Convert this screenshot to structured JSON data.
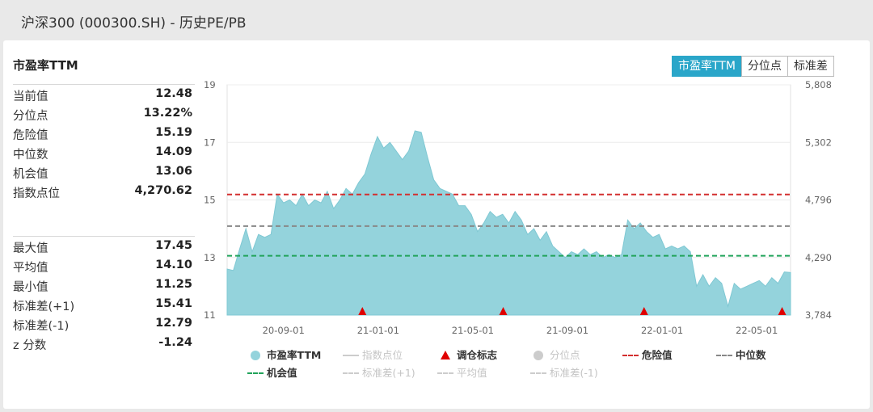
{
  "header": {
    "title": "沪深300 (000300.SH) - 历史PE/PB"
  },
  "stats": {
    "title": "市盈率TTM",
    "group1": [
      {
        "label": "当前值",
        "value": "12.48"
      },
      {
        "label": "分位点",
        "value": "13.22%"
      },
      {
        "label": "危险值",
        "value": "15.19"
      },
      {
        "label": "中位数",
        "value": "14.09"
      },
      {
        "label": "机会值",
        "value": "13.06"
      },
      {
        "label": "指数点位",
        "value": "4,270.62"
      }
    ],
    "group2": [
      {
        "label": "最大值",
        "value": "17.45"
      },
      {
        "label": "平均值",
        "value": "14.10"
      },
      {
        "label": "最小值",
        "value": "11.25"
      },
      {
        "label": "标准差(+1)",
        "value": "15.41"
      },
      {
        "label": "标准差(-1)",
        "value": "12.79"
      },
      {
        "label": "z 分数",
        "value": "-1.24"
      }
    ]
  },
  "tabs": [
    {
      "label": "市盈率TTM",
      "active": true
    },
    {
      "label": "分位点",
      "active": false
    },
    {
      "label": "标准差",
      "active": false
    }
  ],
  "chart_data": {
    "type": "area",
    "left_axis": {
      "ticks": [
        "19",
        "17",
        "15",
        "13",
        "11"
      ],
      "range": [
        11,
        19
      ]
    },
    "right_axis": {
      "ticks": [
        "5,808",
        "5,302",
        "4,796",
        "4,290",
        "3,784"
      ],
      "range": [
        3784,
        5808
      ]
    },
    "x_ticks": [
      "20-09-01",
      "21-01-01",
      "21-05-01",
      "21-09-01",
      "22-01-01",
      "22-05-01"
    ],
    "series": [
      {
        "name": "市盈率TTM",
        "color": "#94d3dc",
        "values": [
          12.6,
          12.55,
          13.3,
          14.0,
          13.2,
          13.8,
          13.7,
          13.8,
          15.2,
          14.9,
          15.0,
          14.8,
          15.2,
          14.8,
          15.0,
          14.9,
          15.3,
          14.7,
          15.0,
          15.4,
          15.2,
          15.6,
          15.9,
          16.6,
          17.2,
          16.8,
          17.0,
          16.7,
          16.4,
          16.7,
          17.4,
          17.35,
          16.5,
          15.7,
          15.4,
          15.3,
          15.2,
          14.8,
          14.8,
          14.5,
          13.9,
          14.2,
          14.6,
          14.4,
          14.5,
          14.2,
          14.6,
          14.3,
          13.8,
          14.0,
          13.6,
          13.9,
          13.4,
          13.2,
          13.0,
          13.2,
          13.1,
          13.3,
          13.1,
          13.2,
          13.0,
          13.1,
          13.0,
          13.1,
          14.3,
          14.0,
          14.2,
          13.9,
          13.7,
          13.8,
          13.3,
          13.4,
          13.3,
          13.4,
          13.2,
          12.0,
          12.4,
          12.0,
          12.3,
          12.1,
          11.3,
          12.1,
          11.9,
          12.0,
          12.1,
          12.2,
          12.0,
          12.3,
          12.1,
          12.5,
          12.48
        ]
      }
    ],
    "reference_lines": [
      {
        "name": "危险值",
        "value": 15.19,
        "color": "#d32f2f"
      },
      {
        "name": "中位数",
        "value": 14.09,
        "color": "#888888"
      },
      {
        "name": "机会值",
        "value": 13.06,
        "color": "#21a35a"
      }
    ],
    "markers": {
      "name": "调仓标志",
      "color": "#e00000",
      "x_fraction": [
        0.24,
        0.49,
        0.74,
        0.985
      ]
    },
    "legend": [
      {
        "name": "市盈率TTM",
        "symbol": "dot",
        "color": "#94d3dc",
        "active": true
      },
      {
        "name": "指数点位",
        "symbol": "line",
        "color": "#cccccc",
        "active": false
      },
      {
        "name": "调仓标志",
        "symbol": "triangle",
        "color": "#e00000",
        "active": true
      },
      {
        "name": "分位点",
        "symbol": "dot",
        "color": "#cccccc",
        "active": false
      },
      {
        "name": "危险值",
        "symbol": "dash",
        "color": "#d32f2f",
        "active": true
      },
      {
        "name": "中位数",
        "symbol": "dash",
        "color": "#888888",
        "active": true
      },
      {
        "name": "机会值",
        "symbol": "dash",
        "color": "#21a35a",
        "active": true
      },
      {
        "name": "标准差(+1)",
        "symbol": "dash",
        "color": "#cccccc",
        "active": false
      },
      {
        "name": "平均值",
        "symbol": "dash",
        "color": "#cccccc",
        "active": false
      },
      {
        "name": "标准差(-1)",
        "symbol": "dash",
        "color": "#cccccc",
        "active": false
      }
    ]
  }
}
